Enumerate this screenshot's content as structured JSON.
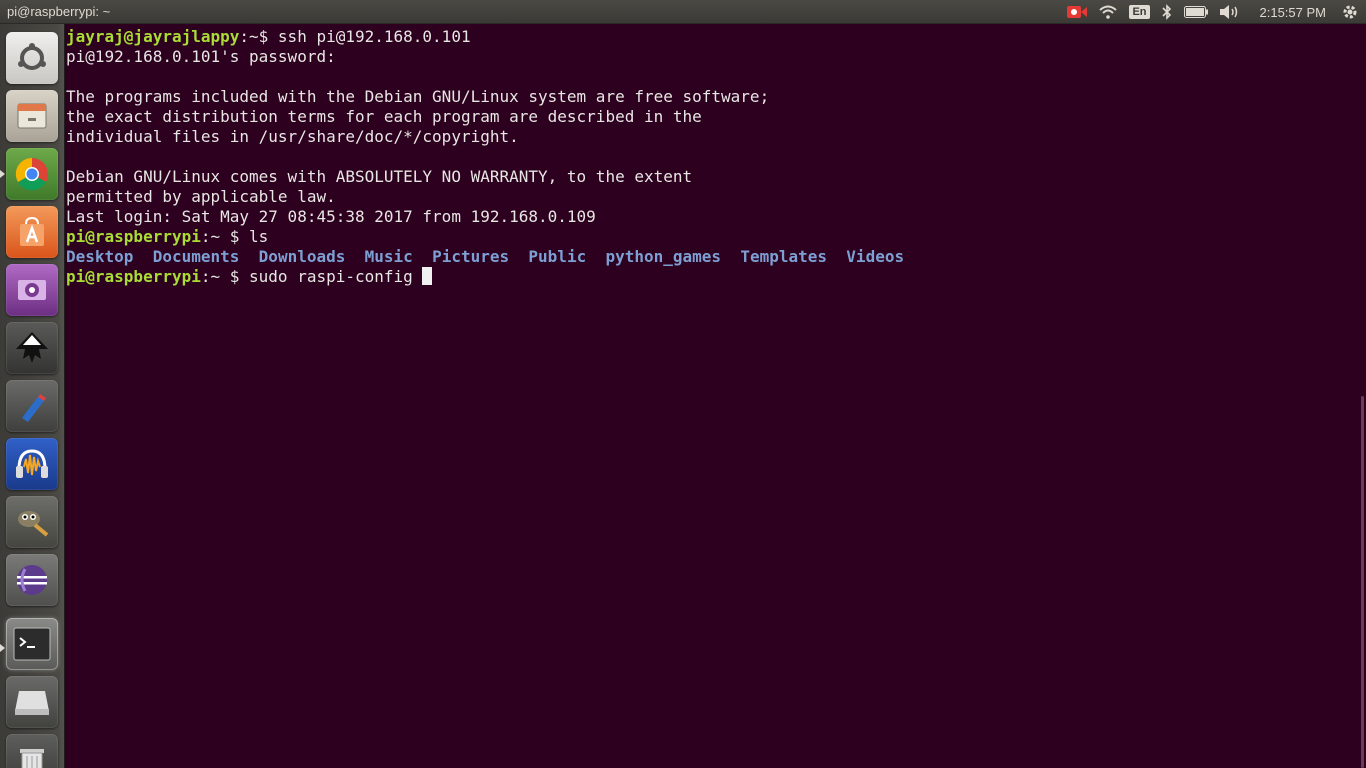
{
  "panel": {
    "window_title": "pi@raspberrypi: ~",
    "language": "En",
    "clock": "2:15:57 PM"
  },
  "launcher": {
    "items": [
      {
        "name": "dash-home-icon",
        "color": "#e95420"
      },
      {
        "name": "file-manager-icon",
        "color": "#d6c6a5"
      },
      {
        "name": "chrome-icon",
        "color": "#4285f4"
      },
      {
        "name": "software-center-icon",
        "color": "#f26d21"
      },
      {
        "name": "video-player-icon",
        "color": "#a74fb9"
      },
      {
        "name": "inkscape-icon",
        "color": "#111111"
      },
      {
        "name": "paint-icon",
        "color": "#2b6dc9"
      },
      {
        "name": "audacity-icon",
        "color": "#f5a623"
      },
      {
        "name": "gimp-icon",
        "color": "#6b6b5a"
      },
      {
        "name": "eclipse-icon",
        "color": "#5c3b8c"
      },
      {
        "name": "terminal-icon",
        "color": "#2c2c2c"
      },
      {
        "name": "removable-drive-icon",
        "color": "#cfcfcf"
      },
      {
        "name": "trash-icon",
        "color": "#bdbdbd"
      }
    ]
  },
  "terminal": {
    "line1": {
      "user": "jayraj@jayrajlappy",
      "sep": ":~$ ",
      "cmd": "ssh pi@192.168.0.101"
    },
    "line2": "pi@192.168.0.101's password:",
    "line4": "The programs included with the Debian GNU/Linux system are free software;",
    "line5": "the exact distribution terms for each program are described in the",
    "line6": "individual files in /usr/share/doc/*/copyright.",
    "line8": "Debian GNU/Linux comes with ABSOLUTELY NO WARRANTY, to the extent",
    "line9": "permitted by applicable law.",
    "line10": "Last login: Sat May 27 08:45:38 2017 from 192.168.0.109",
    "line11": {
      "user": "pi@raspberrypi",
      "sep": ":~ $ ",
      "cmd": "ls"
    },
    "dirs": [
      "Desktop",
      "Documents",
      "Downloads",
      "Music",
      "Pictures",
      "Public",
      "python_games",
      "Templates",
      "Videos"
    ],
    "line13": {
      "user": "pi@raspberrypi",
      "sep": ":~ $ ",
      "cmd": "sudo raspi-config "
    }
  },
  "colors": {
    "terminal_bg": "#2c001e",
    "prompt": "#a9dc35",
    "directory": "#7d9fd3"
  }
}
